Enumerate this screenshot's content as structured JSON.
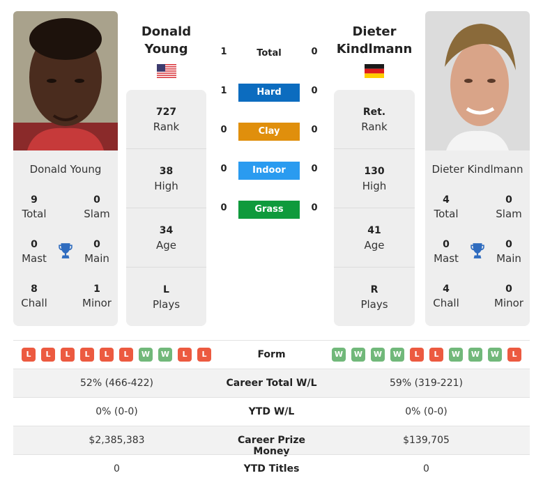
{
  "colors": {
    "hard": "#0c6cbf",
    "clay": "#e08f0c",
    "indoor": "#2a9bf0",
    "grass": "#0f9a3c",
    "win": "#71b87a",
    "loss": "#ec5a40",
    "trophy": "#2f6cbf",
    "card_bg": "#eeeeee"
  },
  "player1": {
    "name_line1": "Donald",
    "name_line2": "Young",
    "full_name": "Donald Young",
    "flag": "usa-flag",
    "rank": "727",
    "rank_label": "Rank",
    "high": "38",
    "high_label": "High",
    "age": "34",
    "age_label": "Age",
    "plays": "L",
    "plays_label": "Plays",
    "titles": {
      "total": "9",
      "total_label": "Total",
      "slam": "0",
      "slam_label": "Slam",
      "mast": "0",
      "mast_label": "Mast",
      "main": "0",
      "main_label": "Main",
      "chall": "8",
      "chall_label": "Chall",
      "minor": "1",
      "minor_label": "Minor"
    },
    "form": [
      "L",
      "L",
      "L",
      "L",
      "L",
      "L",
      "W",
      "W",
      "L",
      "L"
    ]
  },
  "player2": {
    "name_line1": "Dieter",
    "name_line2": "Kindlmann",
    "full_name": "Dieter Kindlmann",
    "flag": "germany-flag",
    "rank": "Ret.",
    "rank_label": "Rank",
    "high": "130",
    "high_label": "High",
    "age": "41",
    "age_label": "Age",
    "plays": "R",
    "plays_label": "Plays",
    "titles": {
      "total": "4",
      "total_label": "Total",
      "slam": "0",
      "slam_label": "Slam",
      "mast": "0",
      "mast_label": "Mast",
      "main": "0",
      "main_label": "Main",
      "chall": "4",
      "chall_label": "Chall",
      "minor": "0",
      "minor_label": "Minor"
    },
    "form": [
      "W",
      "W",
      "W",
      "W",
      "L",
      "L",
      "W",
      "W",
      "W",
      "L"
    ]
  },
  "h2h": {
    "total": {
      "label": "Total",
      "p1": "1",
      "p2": "0"
    },
    "surfaces": [
      {
        "label": "Hard",
        "p1": "1",
        "p2": "0"
      },
      {
        "label": "Clay",
        "p1": "0",
        "p2": "0"
      },
      {
        "label": "Indoor",
        "p1": "0",
        "p2": "0"
      },
      {
        "label": "Grass",
        "p1": "0",
        "p2": "0"
      }
    ]
  },
  "stats": [
    {
      "label": "Form"
    },
    {
      "label": "Career Total W/L",
      "p1": "52% (466-422)",
      "p2": "59% (319-221)"
    },
    {
      "label": "YTD W/L",
      "p1": "0% (0-0)",
      "p2": "0% (0-0)"
    },
    {
      "label": "Career Prize Money",
      "p1": "$2,385,383",
      "p2": "$139,705"
    },
    {
      "label": "YTD Titles",
      "p1": "0",
      "p2": "0"
    }
  ]
}
